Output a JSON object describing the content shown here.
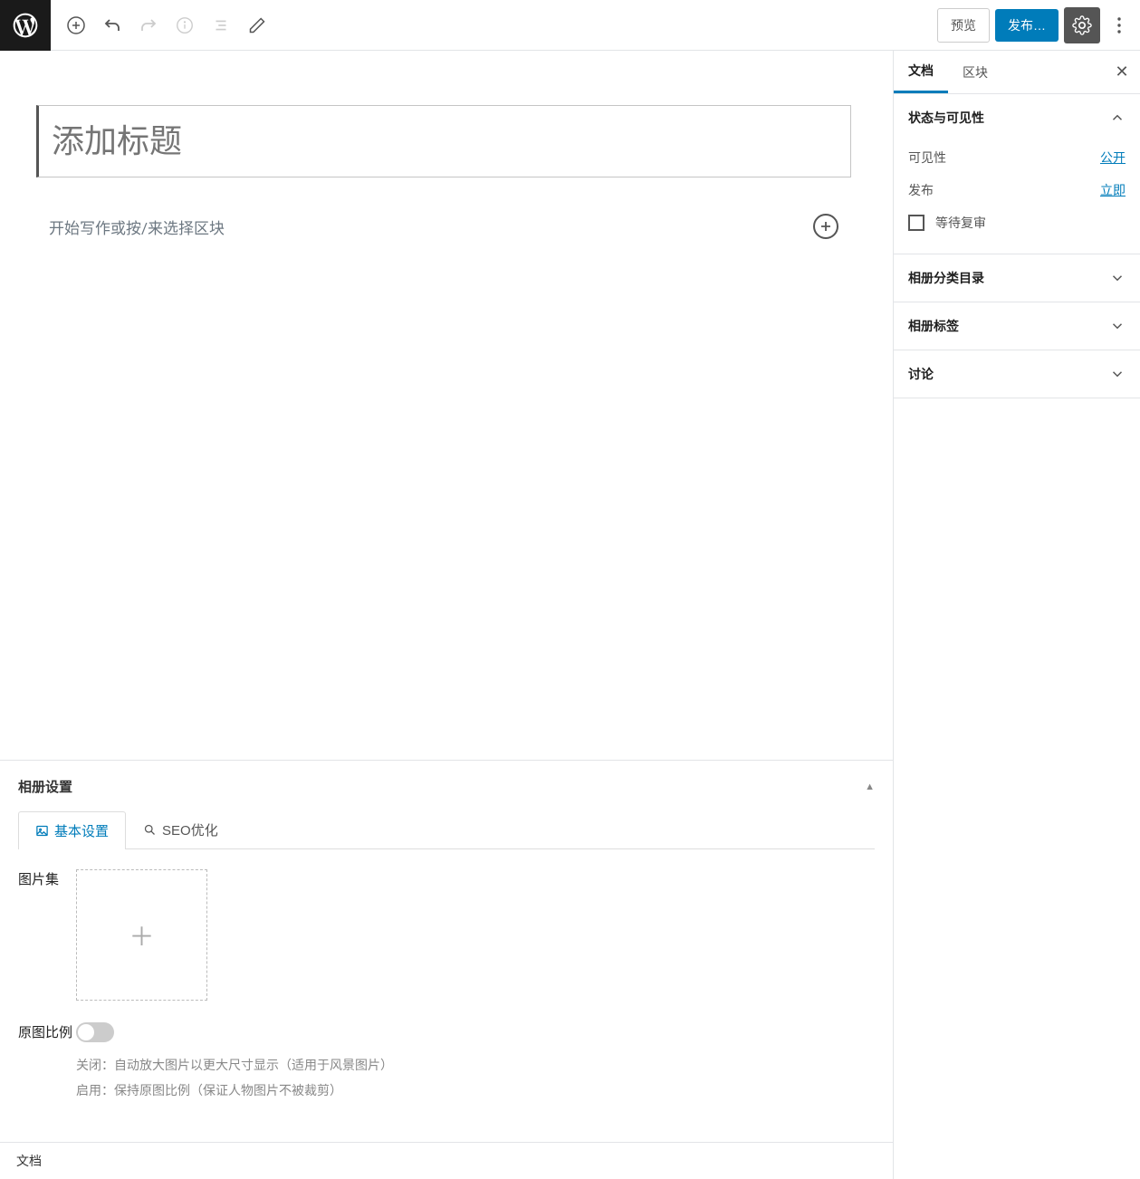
{
  "toolbar": {
    "preview": "预览",
    "publish": "发布…"
  },
  "editor": {
    "title_placeholder": "添加标题",
    "content_placeholder": "开始写作或按/来选择区块"
  },
  "metabox": {
    "title": "相册设置",
    "tabs": {
      "basic": "基本设置",
      "seo": "SEO优化"
    },
    "fields": {
      "image_set_label": "图片集",
      "ratio_label": "原图比例",
      "ratio_off": "关闭：自动放大图片以更大尺寸显示（适用于风景图片）",
      "ratio_on": "启用：保持原图比例（保证人物图片不被裁剪）"
    }
  },
  "footer": {
    "doc": "文档"
  },
  "sidebar": {
    "tabs": {
      "doc": "文档",
      "block": "区块"
    },
    "status_panel": {
      "title": "状态与可见性",
      "visibility_label": "可见性",
      "visibility_value": "公开",
      "publish_label": "发布",
      "publish_value": "立即",
      "pending_label": "等待复审"
    },
    "panels": {
      "categories": "相册分类目录",
      "tags": "相册标签",
      "discussion": "讨论"
    }
  }
}
